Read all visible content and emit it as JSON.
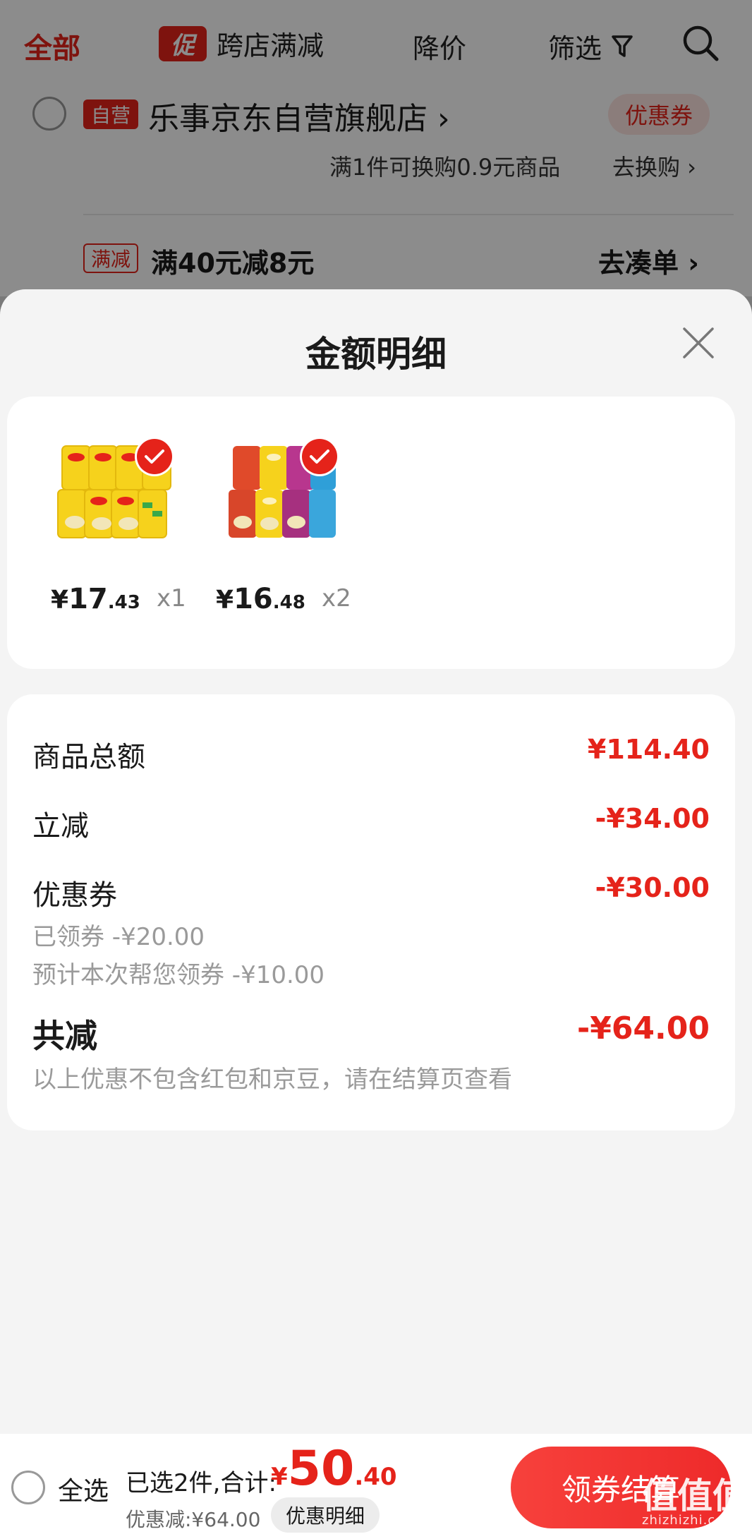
{
  "topbar": {
    "tab_all": "全部",
    "cuxiao_badge": "促",
    "cross_store": "跨店满减",
    "price_drop": "降价",
    "filter": "筛选"
  },
  "store": {
    "badge": "自营",
    "name": "乐事京东自营旗舰店 ›",
    "coupon": "优惠券",
    "exchange_text": "满1件可换购0.9元商品",
    "exchange_link": "去换购 ›",
    "promo_tag": "满减",
    "promo_text": "满40元减8元",
    "promo_link": "去凑单 ›"
  },
  "sheet": {
    "title": "金额明细",
    "goods": [
      {
        "currency": "¥",
        "price_int": "17",
        "price_dec": ".43",
        "qty": "x1"
      },
      {
        "currency": "¥",
        "price_int": "16",
        "price_dec": ".48",
        "qty": "x2"
      }
    ],
    "rows": [
      {
        "label": "商品总额",
        "value": "¥114.40"
      },
      {
        "label": "立减",
        "value": "-¥34.00"
      },
      {
        "label": "优惠券",
        "value": "-¥30.00"
      }
    ],
    "coupon_details": [
      "已领券 -¥20.00",
      "预计本次帮您领券 -¥10.00"
    ],
    "total_label": "共减",
    "total_value": "-¥64.00",
    "note": "以上优惠不包含红包和京豆，请在结算页查看"
  },
  "bottom": {
    "select_all": "全选",
    "selected_info": "已选2件,合计:",
    "currency": "¥",
    "total_int": "50",
    "total_dec": ".40",
    "discount_info": "优惠减:¥64.00",
    "detail_label": "优惠明细",
    "checkout_label": "领券结算"
  },
  "watermark": {
    "glyphs": "值值值",
    "site": "zhizhizhi.com"
  },
  "colors": {
    "accent": "#e5231a",
    "sheet_bg": "#f4f4f4"
  }
}
